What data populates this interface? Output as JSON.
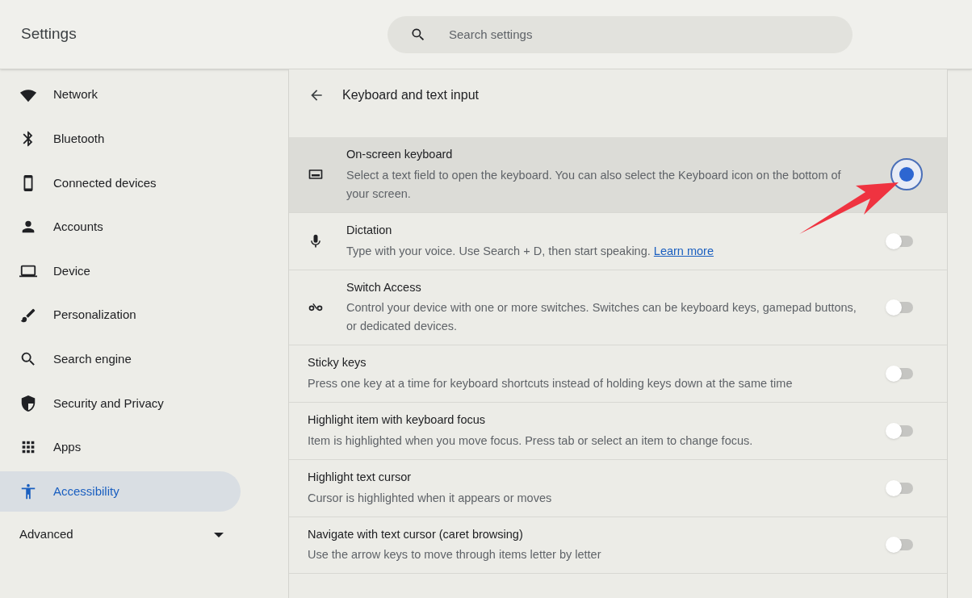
{
  "app_title": "Settings",
  "search": {
    "placeholder": "Search settings"
  },
  "sidebar": {
    "items": [
      {
        "label": "Network",
        "selected": false
      },
      {
        "label": "Bluetooth",
        "selected": false
      },
      {
        "label": "Connected devices",
        "selected": false
      },
      {
        "label": "Accounts",
        "selected": false
      },
      {
        "label": "Device",
        "selected": false
      },
      {
        "label": "Personalization",
        "selected": false
      },
      {
        "label": "Search engine",
        "selected": false
      },
      {
        "label": "Security and Privacy",
        "selected": false
      },
      {
        "label": "Apps",
        "selected": false
      },
      {
        "label": "Accessibility",
        "selected": true
      }
    ],
    "advanced": {
      "label": "Advanced",
      "expanded": false
    }
  },
  "page": {
    "title": "Keyboard and text input",
    "rows": [
      {
        "title": "On-screen keyboard",
        "description": "Select a text field to open the keyboard. You can also select the Keyboard icon on the bottom of your screen.",
        "on": true,
        "highlighted": true
      },
      {
        "title": "Dictation",
        "description": "Type with your voice. Use Search + D, then start speaking.",
        "link": "Learn more",
        "on": false,
        "highlighted": false
      },
      {
        "title": "Switch Access",
        "description": "Control your device with one or more switches. Switches can be keyboard keys, gamepad buttons, or dedicated devices.",
        "on": false,
        "highlighted": false
      },
      {
        "title": "Sticky keys",
        "description": "Press one key at a time for keyboard shortcuts instead of holding keys down at the same time",
        "on": false,
        "highlighted": false
      },
      {
        "title": "Highlight item with keyboard focus",
        "description": "Item is highlighted when you move focus. Press tab or select an item to change focus.",
        "on": false,
        "highlighted": false
      },
      {
        "title": "Highlight text cursor",
        "description": "Cursor is highlighted when it appears or moves",
        "on": false,
        "highlighted": false
      },
      {
        "title": "Navigate with text cursor (caret browsing)",
        "description": "Use the arrow keys to move through items letter by letter",
        "on": false,
        "highlighted": false
      }
    ]
  }
}
